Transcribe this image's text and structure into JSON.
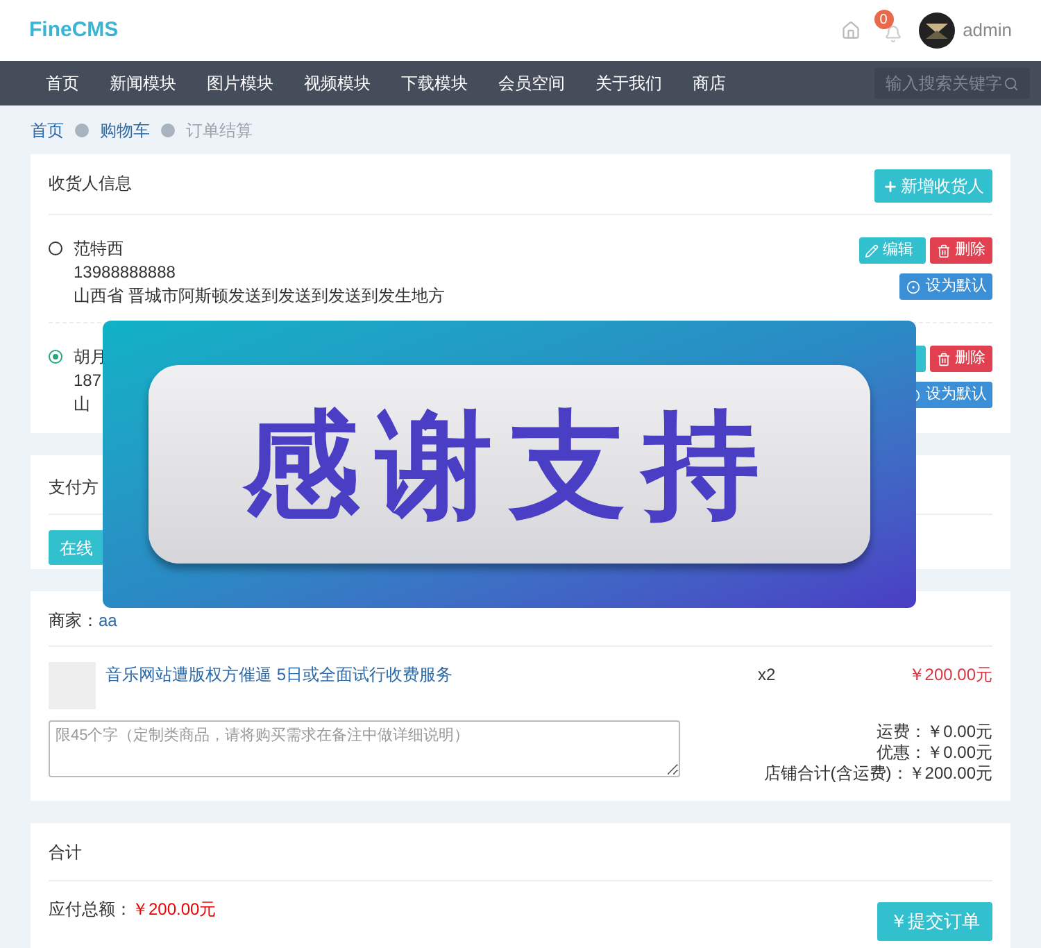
{
  "header": {
    "logo": "FineCMS",
    "notification_count": "0",
    "user": "admin"
  },
  "nav": {
    "items": [
      "首页",
      "新闻模块",
      "图片模块",
      "视频模块",
      "下载模块",
      "会员空间",
      "关于我们",
      "商店"
    ],
    "search": {
      "placeholder": "输入搜索关键字"
    }
  },
  "breadcrumb": [
    {
      "label": "首页",
      "current": false
    },
    {
      "label": "购物车",
      "current": false
    },
    {
      "label": "订单结算",
      "current": true
    }
  ],
  "receiver": {
    "title": "收货人信息",
    "add_button": "新增收货人",
    "addresses": [
      {
        "name": "范特西",
        "phone": "13988888888",
        "address": "山西省 晋城市阿斯顿发送到发送到发送到发生地方",
        "selected": false,
        "edit_button": "编辑",
        "delete_button": "删除",
        "default_button": "设为默认"
      },
      {
        "name": "胡月",
        "phone": "187",
        "address": "山",
        "selected": true,
        "delete_button": "删除",
        "default_button": "设为默认"
      }
    ]
  },
  "payment": {
    "title": "支付方",
    "button": "在线"
  },
  "shop": {
    "label": "商家：",
    "name": "aa",
    "product": {
      "title": "音乐网站遭版权方催逼 5日或全面试行收费服务",
      "quantity": "x2",
      "price": "￥200.00元"
    },
    "note": {
      "placeholder": "限45个字（定制类商品，请将购买需求在备注中做详细说明）"
    },
    "totals": [
      {
        "label": "运费：",
        "value": "￥0.00元"
      },
      {
        "label": "优惠：",
        "value": "￥0.00元"
      },
      {
        "label": "店铺合计(含运费)：",
        "value": "￥200.00元"
      }
    ]
  },
  "summary": {
    "title": "合计",
    "total_label": "应付总额：",
    "total_value": "￥200.00元",
    "submit_button": "￥提交订单"
  },
  "overlay": {
    "text": "感谢支持"
  }
}
